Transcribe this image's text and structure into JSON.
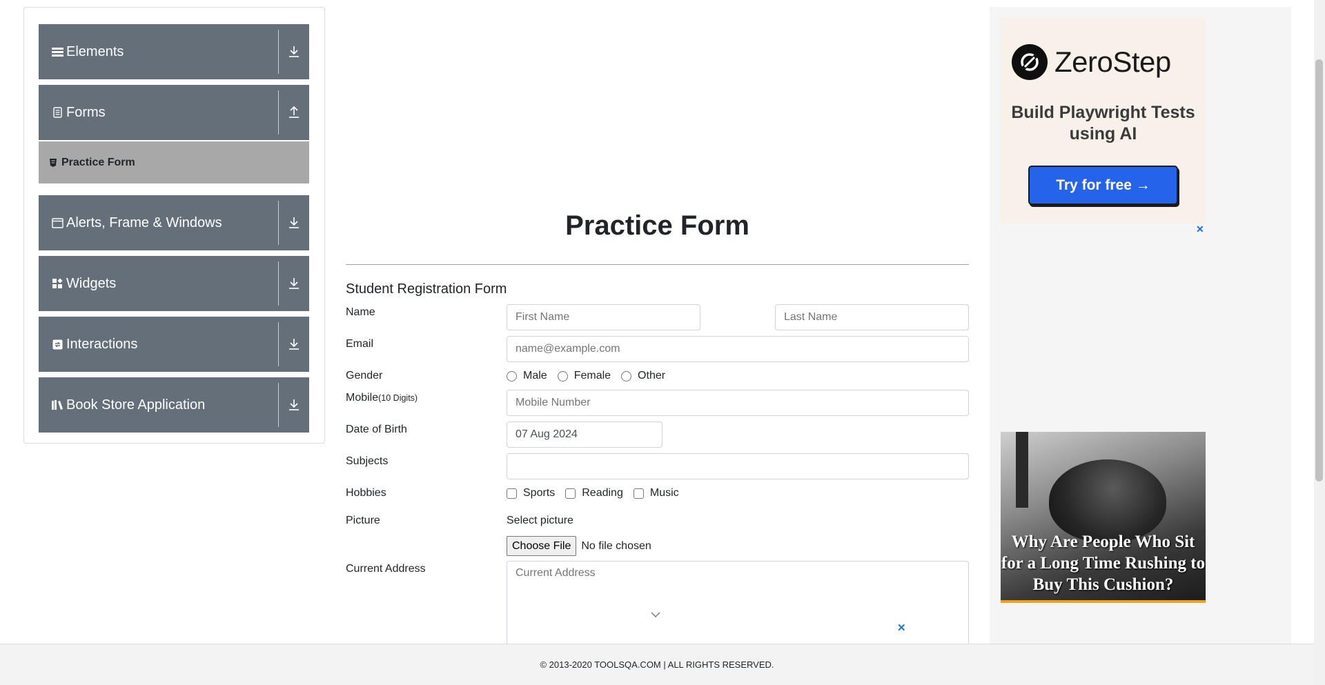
{
  "sidebar": {
    "groups": [
      {
        "label": "Elements",
        "icon": "menu-icon",
        "arrow": "download"
      },
      {
        "label": "Forms",
        "icon": "document-icon",
        "arrow": "upload"
      },
      {
        "label": "Alerts, Frame & Windows",
        "icon": "window-icon",
        "arrow": "download"
      },
      {
        "label": "Widgets",
        "icon": "widgets-icon",
        "arrow": "download"
      },
      {
        "label": "Interactions",
        "icon": "interaction-icon",
        "arrow": "download"
      },
      {
        "label": "Book Store Application",
        "icon": "books-icon",
        "arrow": "download"
      }
    ],
    "active_item": {
      "label": "Practice Form",
      "icon": "html-icon"
    }
  },
  "page": {
    "title": "Practice Form",
    "subtitle": "Student Registration Form"
  },
  "form": {
    "name_label": "Name",
    "first_name_placeholder": "First Name",
    "last_name_placeholder": "Last Name",
    "email_label": "Email",
    "email_placeholder": "name@example.com",
    "gender_label": "Gender",
    "gender_options": [
      "Male",
      "Female",
      "Other"
    ],
    "mobile_label": "Mobile",
    "mobile_hint": "(10 Digits)",
    "mobile_placeholder": "Mobile Number",
    "dob_label": "Date of Birth",
    "dob_value": "07 Aug 2024",
    "subjects_label": "Subjects",
    "hobbies_label": "Hobbies",
    "hobby_options": [
      "Sports",
      "Reading",
      "Music"
    ],
    "picture_label": "Picture",
    "picture_caption": "Select picture",
    "choose_file_label": "Choose File",
    "no_file_text": "No file chosen",
    "address_label": "Current Address",
    "address_placeholder": "Current Address"
  },
  "ads": {
    "ad1": {
      "brand": "ZeroStep",
      "tagline": "Build Playwright Tests using AI",
      "button": "Try for free →"
    },
    "ad2": {
      "headline": "Why Are People Who Sit for a Long Time Rushing to Buy This Cushion?"
    },
    "close_symbol": "✕"
  },
  "footer": {
    "text": "© 2013-2020 TOOLSQA.COM | ALL RIGHTS RESERVED."
  },
  "colors": {
    "sidebar_group": "#656f7a",
    "active_item": "#a8a8a8",
    "ad_button": "#2563eb"
  }
}
